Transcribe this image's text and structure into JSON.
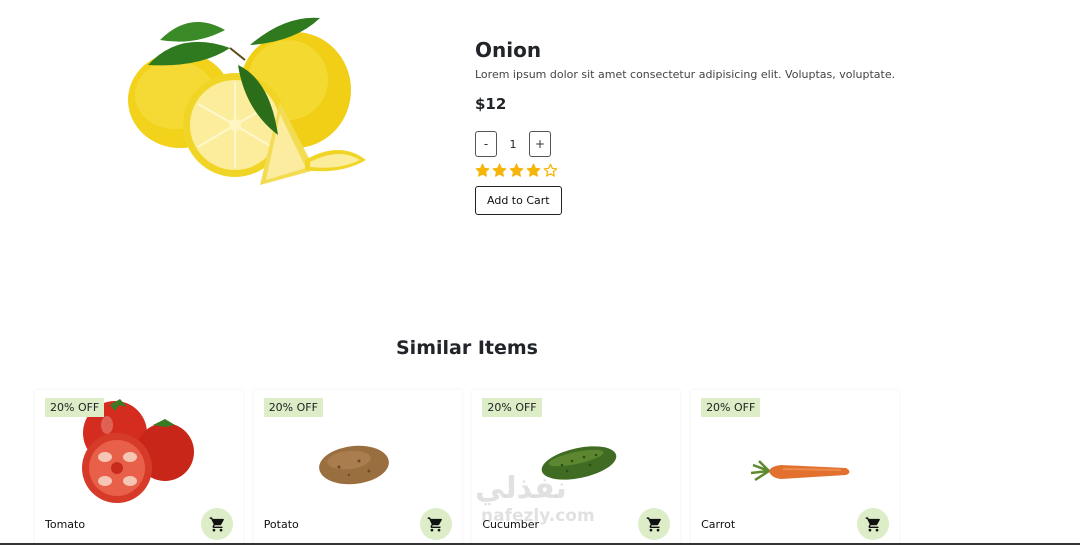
{
  "product": {
    "title": "Onion",
    "description": "Lorem ipsum dolor sit amet consectetur adipisicing elit. Voluptas, voluptate.",
    "price": "$12",
    "quantity": {
      "decrement_label": "-",
      "value": "1",
      "increment_label": "+"
    },
    "rating": 4,
    "rating_max": 5,
    "add_to_cart_label": "Add to Cart",
    "image_icon": "lemon-image"
  },
  "similar": {
    "title": "Similar Items",
    "items": [
      {
        "name": "Tomato",
        "badge": "20% OFF",
        "image_icon": "tomato-image",
        "cart_icon": "cart-icon"
      },
      {
        "name": "Potato",
        "badge": "20% OFF",
        "image_icon": "potato-image",
        "cart_icon": "cart-icon"
      },
      {
        "name": "Cucumber",
        "badge": "20% OFF",
        "image_icon": "cucumber-image",
        "cart_icon": "cart-icon"
      },
      {
        "name": "Carrot",
        "badge": "20% OFF",
        "image_icon": "carrot-image",
        "cart_icon": "cart-icon"
      }
    ]
  },
  "watermark": {
    "arabic": "نفذلي",
    "latin": "nafezly.com"
  },
  "colors": {
    "badge_bg": "#dcedc8",
    "star": "#f5b50a",
    "text": "#212529"
  }
}
